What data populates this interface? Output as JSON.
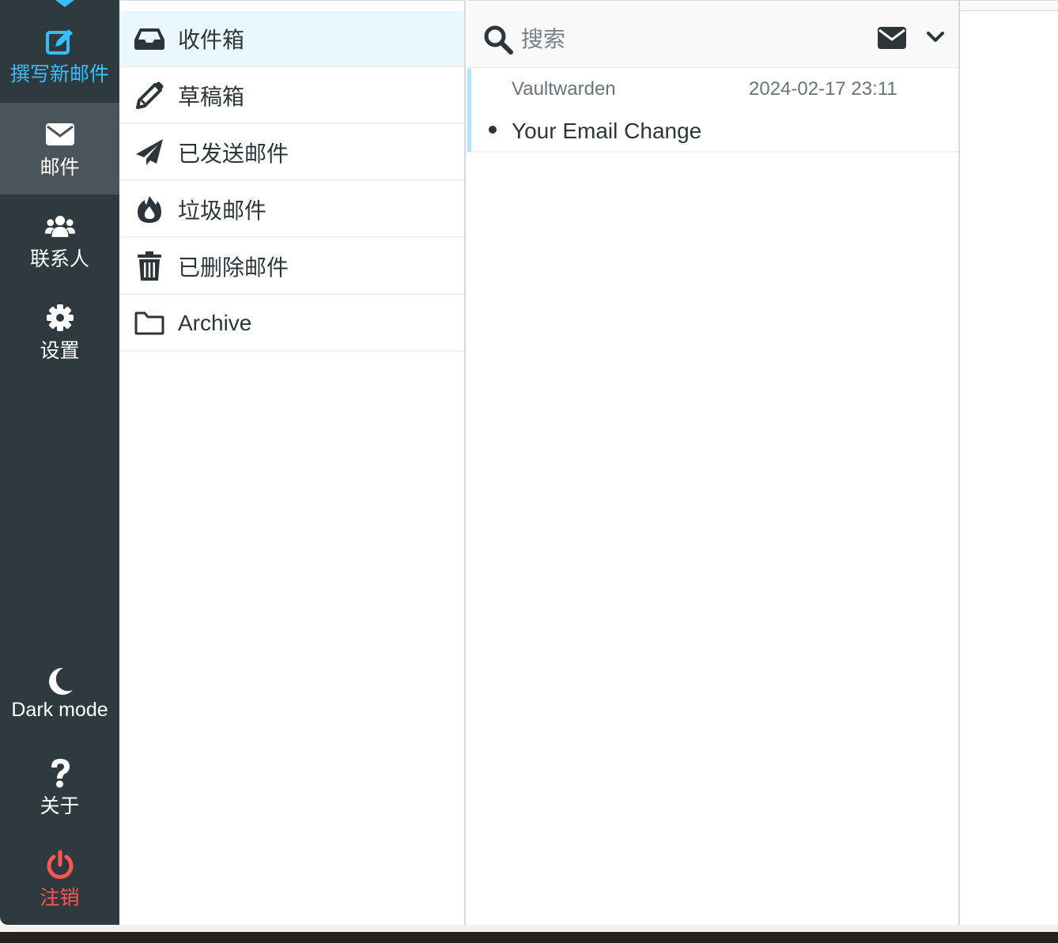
{
  "taskmenu": {
    "compose": {
      "label": "撰写新邮件",
      "icon": "compose-icon"
    },
    "mail": {
      "label": "邮件",
      "icon": "envelope-icon"
    },
    "contacts": {
      "label": "联系人",
      "icon": "users-icon"
    },
    "settings": {
      "label": "设置",
      "icon": "gear-icon"
    },
    "darkmode": {
      "label": "Dark mode",
      "icon": "moon-icon"
    },
    "about": {
      "label": "关于",
      "icon": "question-icon"
    },
    "logout": {
      "label": "注销",
      "icon": "power-icon"
    }
  },
  "folders": [
    {
      "name": "收件箱",
      "icon": "inbox-icon",
      "selected": true
    },
    {
      "name": "草稿箱",
      "icon": "pencil-icon"
    },
    {
      "name": "已发送邮件",
      "icon": "paper-plane-icon"
    },
    {
      "name": "垃圾邮件",
      "icon": "fire-icon"
    },
    {
      "name": "已删除邮件",
      "icon": "trash-icon"
    },
    {
      "name": "Archive",
      "icon": "folder-icon"
    }
  ],
  "search": {
    "placeholder": "搜索"
  },
  "messages": [
    {
      "from": "Vaultwarden",
      "date": "2024-02-17 23:11",
      "subject": "Your Email Change",
      "unread": true
    }
  ],
  "colors": {
    "sidebar_bg": "#2f3a3f",
    "sidebar_selected": "#4a555b",
    "accent": "#37beff",
    "logout": "#ff5552",
    "selected_folder_bg": "#eaf7fe"
  }
}
